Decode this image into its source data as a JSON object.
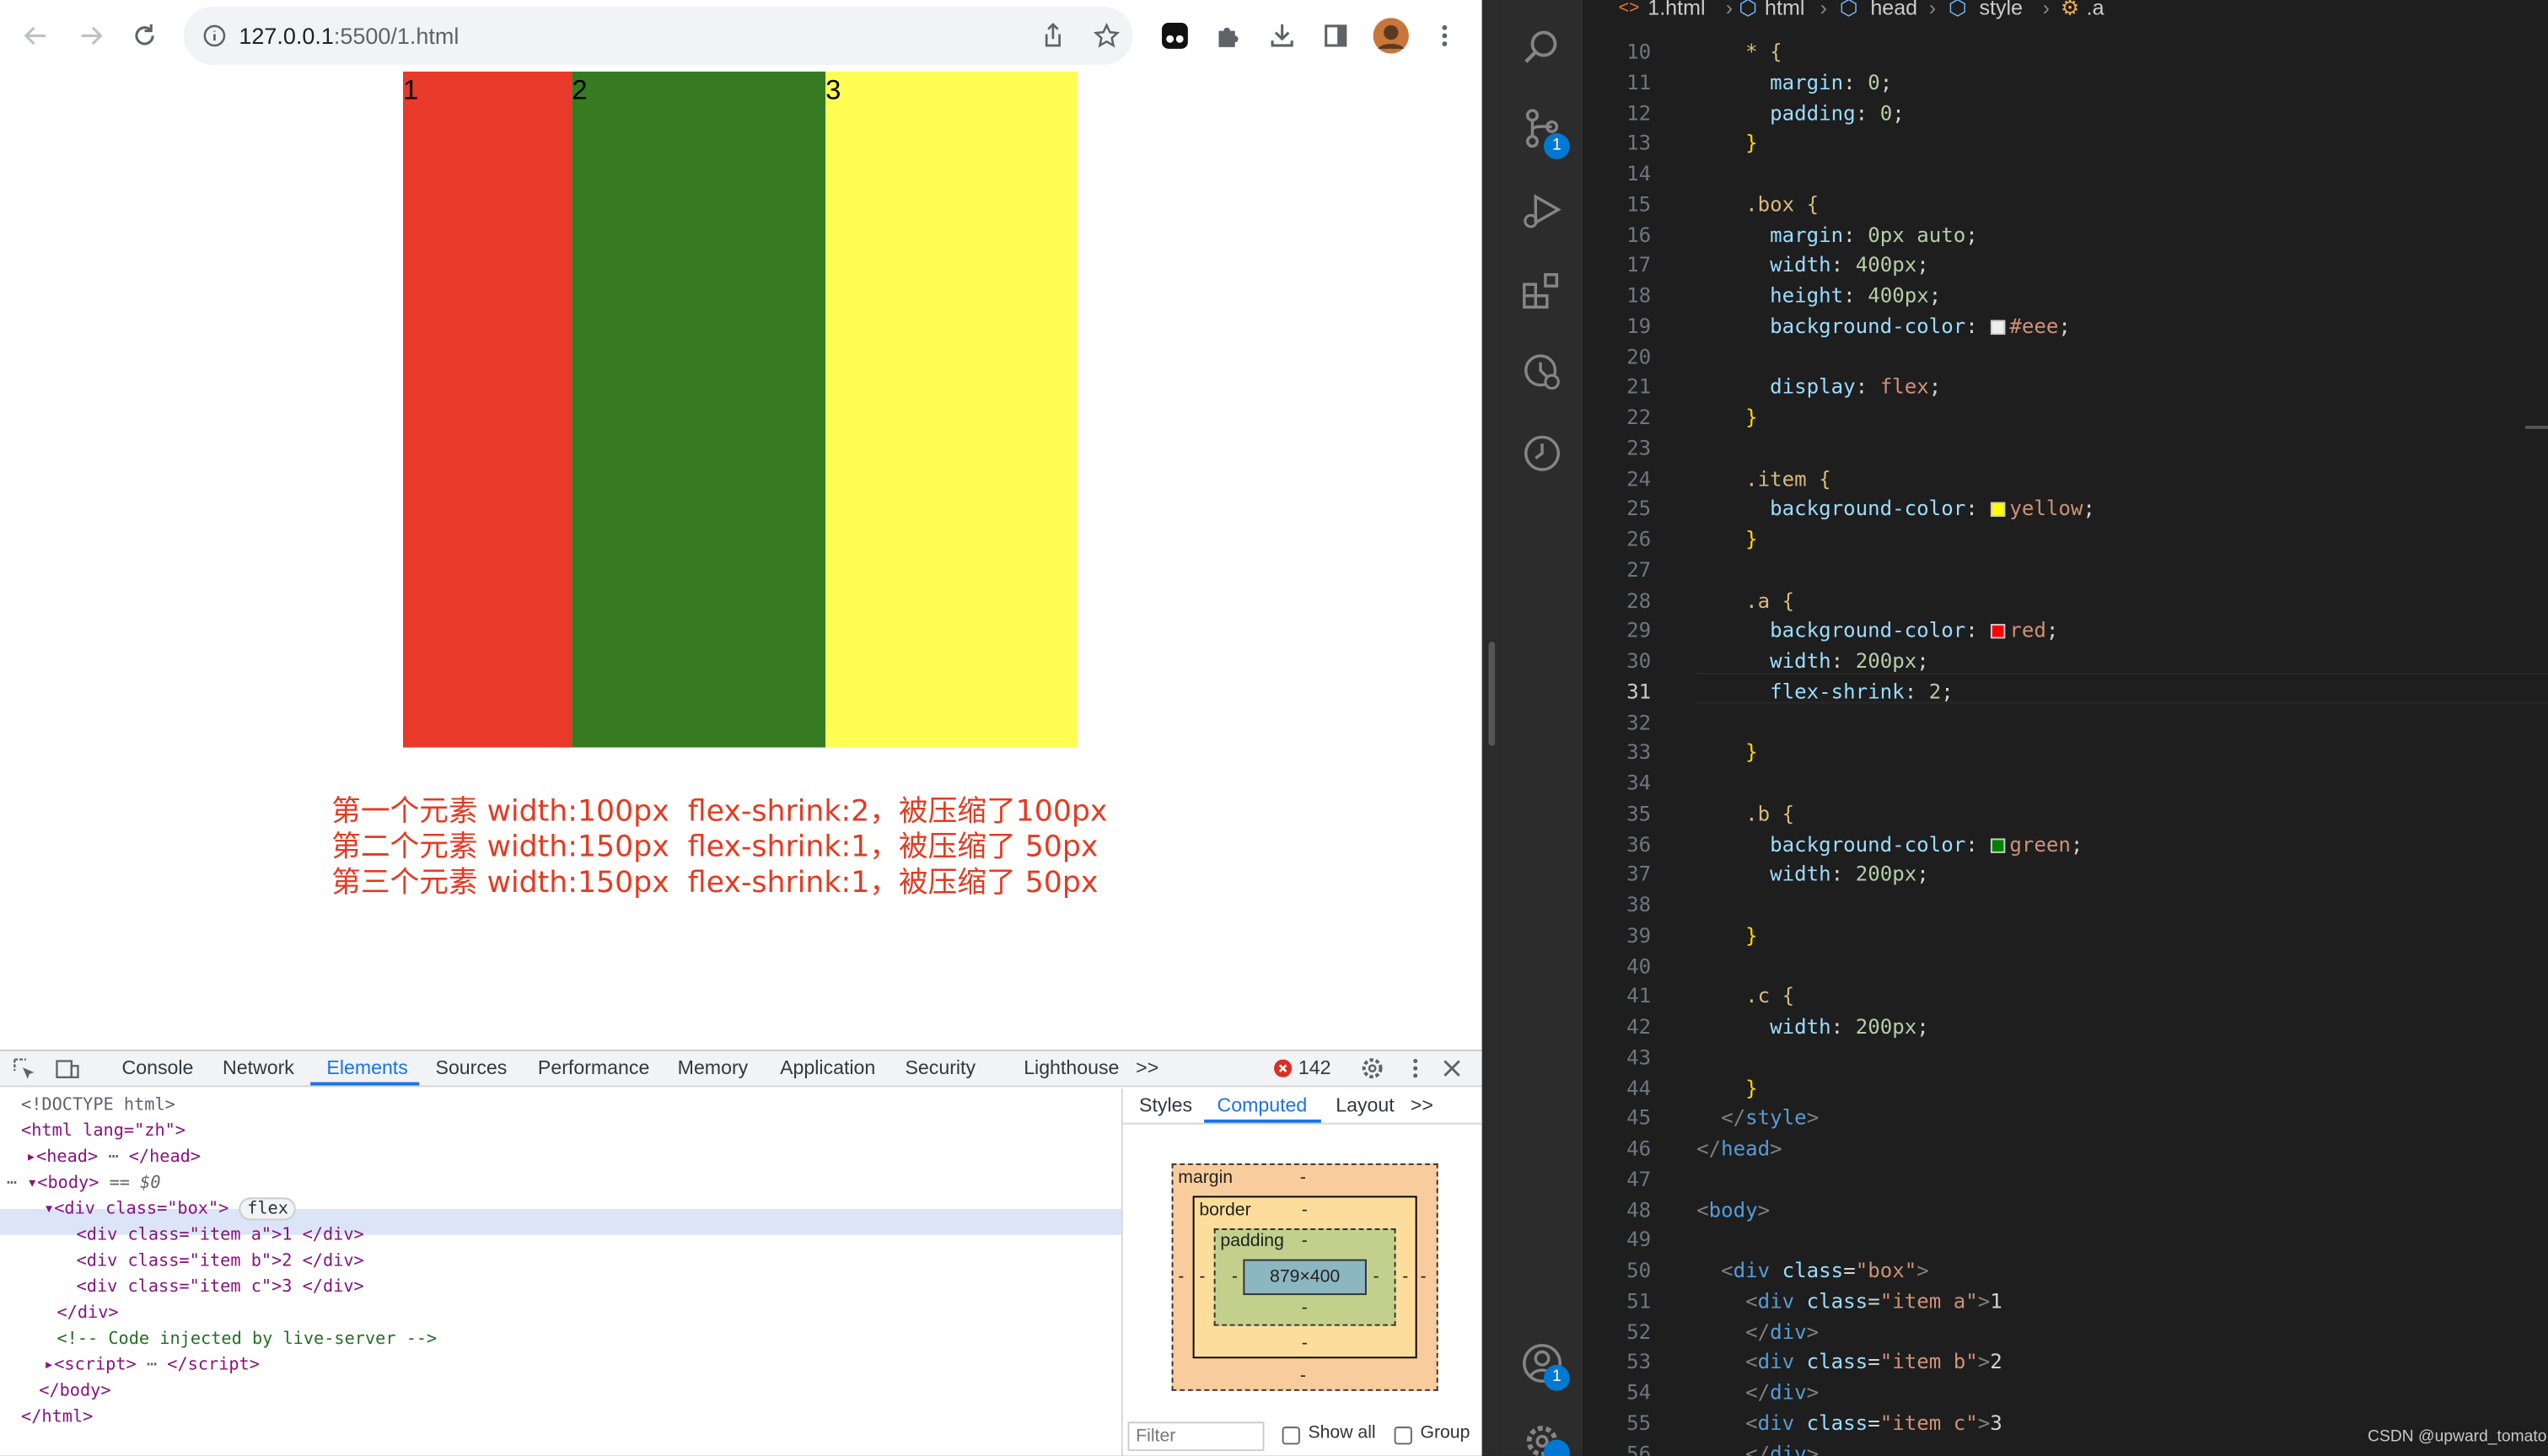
{
  "browser": {
    "url_host": "127.0.0.1",
    "url_rest": ":5500/1.html",
    "page": {
      "items": [
        {
          "label": "1",
          "color": "#e8392a"
        },
        {
          "label": "2",
          "color": "#367b21"
        },
        {
          "label": "3",
          "color": "#fffd54"
        }
      ],
      "note_lines": [
        "第一个元素 width:100px  flex-shrink:2，被压缩了100px",
        "第二个元素 width:150px  flex-shrink:1，被压缩了 50px",
        "第三个元素 width:150px  flex-shrink:1，被压缩了 50px"
      ]
    },
    "devtools": {
      "tabs": [
        "Console",
        "Network",
        "Elements",
        "Sources",
        "Performance",
        "Memory",
        "Application",
        "Security",
        "Lighthouse"
      ],
      "active_tab": "Elements",
      "more": ">>",
      "error_count": "142",
      "dom_lines": [
        "<!DOCTYPE html>",
        "<html lang=\"zh\">",
        "<head>",
        "</head>",
        "<body>",
        "== $0",
        "<div class=\"box\">",
        "flex",
        "<div class=\"item a\">1 </div>",
        "<div class=\"item b\">2 </div>",
        "<div class=\"item c\">3 </div>",
        "</div>",
        "<!-- Code injected by live-server -->",
        "<script>",
        "</script>",
        "</body>",
        "</html>"
      ],
      "side_tabs": [
        "Styles",
        "Computed",
        "Layout"
      ],
      "side_active": "Computed",
      "box_model": {
        "margin_label": "margin",
        "border_label": "border",
        "padding_label": "padding",
        "content": "879×400",
        "dash": "-"
      },
      "filter_placeholder": "Filter",
      "show_all": "Show all",
      "group": "Group"
    }
  },
  "vscode": {
    "breadcrumb": [
      "1.html",
      "html",
      "head",
      "style",
      ".a"
    ],
    "scm_badge": "1",
    "account_badge": "1",
    "current_line": "31",
    "lines": [
      {
        "n": "10",
        "code": "    * {"
      },
      {
        "n": "11",
        "code": "      margin: 0;"
      },
      {
        "n": "12",
        "code": "      padding: 0;"
      },
      {
        "n": "13",
        "code": "    }"
      },
      {
        "n": "14",
        "code": ""
      },
      {
        "n": "15",
        "code": "    .box {"
      },
      {
        "n": "16",
        "code": "      margin: 0px auto;"
      },
      {
        "n": "17",
        "code": "      width: 400px;"
      },
      {
        "n": "18",
        "code": "      height: 400px;"
      },
      {
        "n": "19",
        "code": "      background-color: #eee;",
        "swatch": "#eeeeee"
      },
      {
        "n": "20",
        "code": ""
      },
      {
        "n": "21",
        "code": "      display: flex;"
      },
      {
        "n": "22",
        "code": "    }"
      },
      {
        "n": "23",
        "code": ""
      },
      {
        "n": "24",
        "code": "    .item {"
      },
      {
        "n": "25",
        "code": "      background-color: yellow;",
        "swatch": "#ffff00"
      },
      {
        "n": "26",
        "code": "    }"
      },
      {
        "n": "27",
        "code": ""
      },
      {
        "n": "28",
        "code": "    .a {"
      },
      {
        "n": "29",
        "code": "      background-color: red;",
        "swatch": "#ff0000"
      },
      {
        "n": "30",
        "code": "      width: 200px;"
      },
      {
        "n": "31",
        "code": "      flex-shrink: 2;"
      },
      {
        "n": "32",
        "code": ""
      },
      {
        "n": "33",
        "code": "    }"
      },
      {
        "n": "34",
        "code": ""
      },
      {
        "n": "35",
        "code": "    .b {"
      },
      {
        "n": "36",
        "code": "      background-color: green;",
        "swatch": "#008000"
      },
      {
        "n": "37",
        "code": "      width: 200px;"
      },
      {
        "n": "38",
        "code": ""
      },
      {
        "n": "39",
        "code": "    }"
      },
      {
        "n": "40",
        "code": ""
      },
      {
        "n": "41",
        "code": "    .c {"
      },
      {
        "n": "42",
        "code": "      width: 200px;"
      },
      {
        "n": "43",
        "code": ""
      },
      {
        "n": "44",
        "code": "    }"
      },
      {
        "n": "45",
        "code": "  </style>"
      },
      {
        "n": "46",
        "code": "</head>"
      },
      {
        "n": "47",
        "code": ""
      },
      {
        "n": "48",
        "code": "<body>"
      },
      {
        "n": "49",
        "code": ""
      },
      {
        "n": "50",
        "code": "  <div class=\"box\">"
      },
      {
        "n": "51",
        "code": "    <div class=\"item a\">1"
      },
      {
        "n": "52",
        "code": "    </div>"
      },
      {
        "n": "53",
        "code": "    <div class=\"item b\">2"
      },
      {
        "n": "54",
        "code": "    </div>"
      },
      {
        "n": "55",
        "code": "    <div class=\"item c\">3"
      },
      {
        "n": "56",
        "code": "    </div>"
      }
    ],
    "watermark": "CSDN @upward_tomato"
  }
}
